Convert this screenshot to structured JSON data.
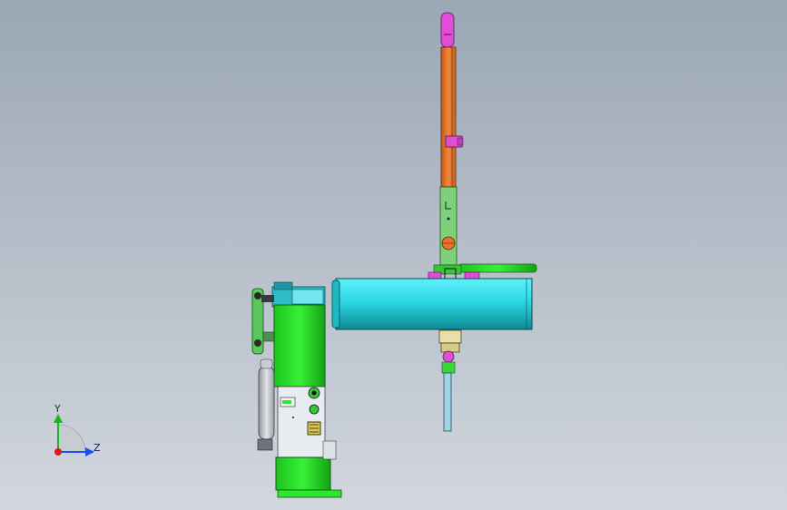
{
  "triad": {
    "y_label": "Y",
    "z_label": "Z"
  },
  "colors": {
    "background_top": "#9ba7b5",
    "background_bottom": "#d2d7de",
    "green": "#2ee62e",
    "green_dark": "#0f6b0f",
    "cyan": "#2bd9e6",
    "cyan_dark": "#0e8a94",
    "orange": "#e8722a",
    "magenta": "#e34cd6",
    "light_green": "#7fd07a",
    "steel": "#c9ccd2",
    "axis_y": "#18b818",
    "axis_z": "#1a4ff0",
    "axis_x": "#e01818"
  }
}
